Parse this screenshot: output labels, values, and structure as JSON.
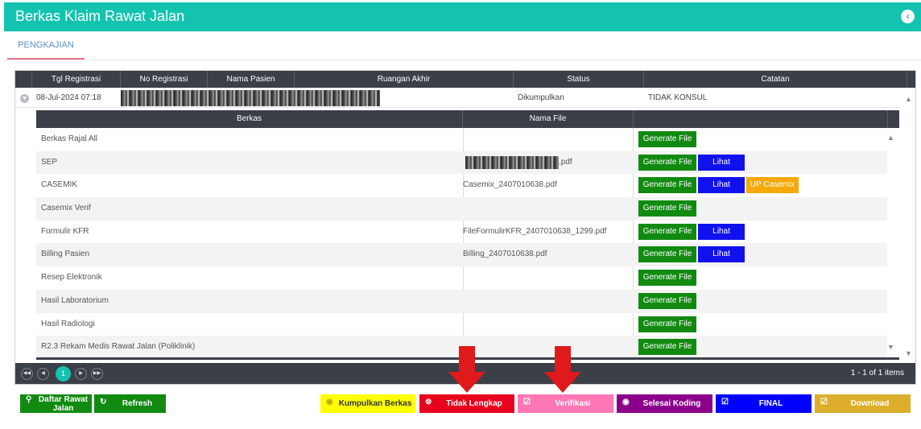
{
  "window": {
    "title": "Berkas Klaim Rawat Jalan",
    "back_icon": "chevron-left-circle-icon"
  },
  "tabs": [
    {
      "label": "PENGKAJIAN",
      "active": true
    }
  ],
  "grid": {
    "columns": [
      "Tgl Registrasi",
      "No Registrasi",
      "Nama Pasien",
      "Ruangan Akhir",
      "Status",
      "Catatan"
    ],
    "row": {
      "tgl_registrasi": "08-Jul-2024 07:18",
      "no_registrasi": "",
      "nama_pasien": "",
      "ruangan_akhir": "",
      "status": "Dikumpulkan",
      "catatan": "TIDAK KONSUL"
    }
  },
  "subgrid": {
    "columns": [
      "Berkas",
      "Nama File"
    ],
    "rows": [
      {
        "berkas": "Berkas Rajal All",
        "file": ""
      },
      {
        "berkas": "SEP",
        "file": ".pdf"
      },
      {
        "berkas": "CASEMIK",
        "file": "Casemix_2407010638.pdf"
      },
      {
        "berkas": "Casemix Verif",
        "file": ""
      },
      {
        "berkas": "Formulir KFR",
        "file": "FileFormulirKFR_2407010638_1299.pdf"
      },
      {
        "berkas": "Billing Pasien",
        "file": "Billing_2407010638.pdf"
      },
      {
        "berkas": "Resep Elektronik",
        "file": ""
      },
      {
        "berkas": "Hasil Laboratorium",
        "file": ""
      },
      {
        "berkas": "Hasil Radiologi",
        "file": ""
      },
      {
        "berkas": "R2.3 Rekam Medis Rawat Jalan (Poliklinik)",
        "file": ""
      }
    ],
    "buttons": {
      "generate": "Generate File",
      "lihat": "Lihat",
      "up_casemix": "UP Casemix"
    }
  },
  "pager": {
    "current_page": "1",
    "info": "1 - 1 of 1 items"
  },
  "actions": {
    "daftar_line1": "Daftar Rawat",
    "daftar_line2": "Jalan",
    "refresh": "Refresh",
    "kumpulkan": "Kumpulkan Berkas",
    "tidak_lengkap": "Tidak Lengkap",
    "verifikasi": "Verifikasi",
    "selesai_koding": "Selesai Koding",
    "final": "FINAL",
    "download": "Download"
  },
  "colors": {
    "accent": "#13c3b0",
    "header_dark": "#3a3f48",
    "generate": "#128a12",
    "lihat": "#1111ee",
    "up_casemix": "#f5a90a",
    "kumpulkan": "#ffff00",
    "tidak_lengkap": "#e8001c",
    "verifikasi": "#ff77b4",
    "selesai_koding": "#8b008b",
    "final": "#0000ff",
    "download": "#dcae2c",
    "annotation_arrow": "#e0191c"
  }
}
